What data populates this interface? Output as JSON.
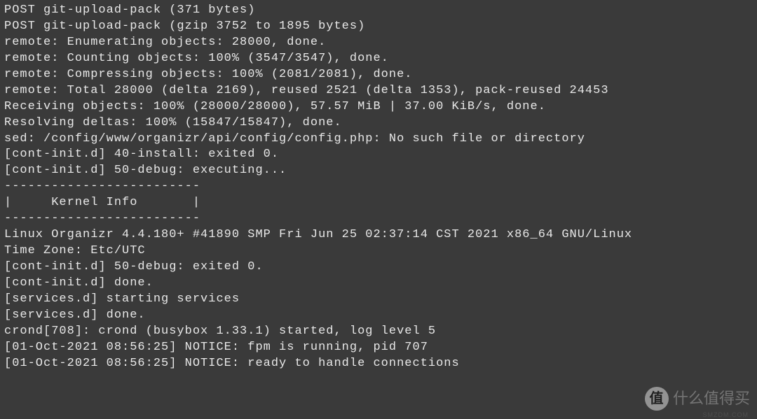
{
  "terminal": {
    "lines": [
      "POST git-upload-pack (371 bytes)",
      "POST git-upload-pack (gzip 3752 to 1895 bytes)",
      "remote: Enumerating objects: 28000, done.",
      "remote: Counting objects: 100% (3547/3547), done.",
      "remote: Compressing objects: 100% (2081/2081), done.",
      "remote: Total 28000 (delta 2169), reused 2521 (delta 1353), pack-reused 24453",
      "Receiving objects: 100% (28000/28000), 57.57 MiB | 37.00 KiB/s, done.",
      "Resolving deltas: 100% (15847/15847), done.",
      "sed: /config/www/organizr/api/config/config.php: No such file or directory",
      "[cont-init.d] 40-install: exited 0.",
      "[cont-init.d] 50-debug: executing...",
      "-------------------------",
      "|     Kernel Info       |",
      "-------------------------",
      "Linux Organizr 4.4.180+ #41890 SMP Fri Jun 25 02:37:14 CST 2021 x86_64 GNU/Linux",
      "Time Zone: Etc/UTC",
      "[cont-init.d] 50-debug: exited 0.",
      "[cont-init.d] done.",
      "[services.d] starting services",
      "[services.d] done.",
      "crond[708]: crond (busybox 1.33.1) started, log level 5",
      "[01-Oct-2021 08:56:25] NOTICE: fpm is running, pid 707",
      "[01-Oct-2021 08:56:25] NOTICE: ready to handle connections"
    ]
  },
  "watermark": {
    "logo_char": "值",
    "text": "什么值得买",
    "sub": "SMZDM.COM"
  }
}
